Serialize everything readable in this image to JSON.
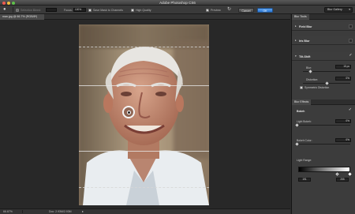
{
  "window": {
    "title": "Adobe Photoshop CS6",
    "traffic_colors": [
      "#ee5b50",
      "#f2be3c",
      "#5fc04b"
    ]
  },
  "options_bar": {
    "selection_bleed_label": "Selection Bleed:",
    "focus_label": "Focus:",
    "focus_value": "100%",
    "save_mask_label": "Save Mask to Channels",
    "high_quality_label": "High Quality",
    "preview_label": "Preview",
    "cancel_label": "Cancel",
    "ok_label": "OK",
    "workspace_label": "Blur Gallery"
  },
  "document": {
    "tab_label": "man.jpg @ 66.7% (RGB/8*)"
  },
  "status": {
    "zoom": "66.67%",
    "doc_info": "Doc: 2.93M/2.93M"
  },
  "panel": {
    "tools_header": "Blur Tools",
    "sections": [
      {
        "name": "Field Blur",
        "expanded": false,
        "enabled": false
      },
      {
        "name": "Iris Blur",
        "expanded": false,
        "enabled": false
      },
      {
        "name": "Tilt-Shift",
        "expanded": true,
        "enabled": true
      }
    ],
    "blur_label": "Blur:",
    "blur_value": "15 px",
    "blur_fraction": 0.15,
    "distortion_label": "Distortion:",
    "distortion_value": "0%",
    "distortion_fraction": 0.5,
    "symmetric_label": "Symmetric Distortion",
    "effects_header": "Blur Effects",
    "bokeh_label": "Bokeh",
    "light_bokeh_label": "Light Bokeh:",
    "light_bokeh_value": "0%",
    "light_bokeh_fraction": 0.0,
    "bokeh_color_label": "Bokeh Color:",
    "bokeh_color_value": "0%",
    "bokeh_color_fraction": 0.0,
    "light_range_label": "Light Range:",
    "light_range_low": "191",
    "light_range_high": "255",
    "accent_color": "#2f7cd8"
  }
}
